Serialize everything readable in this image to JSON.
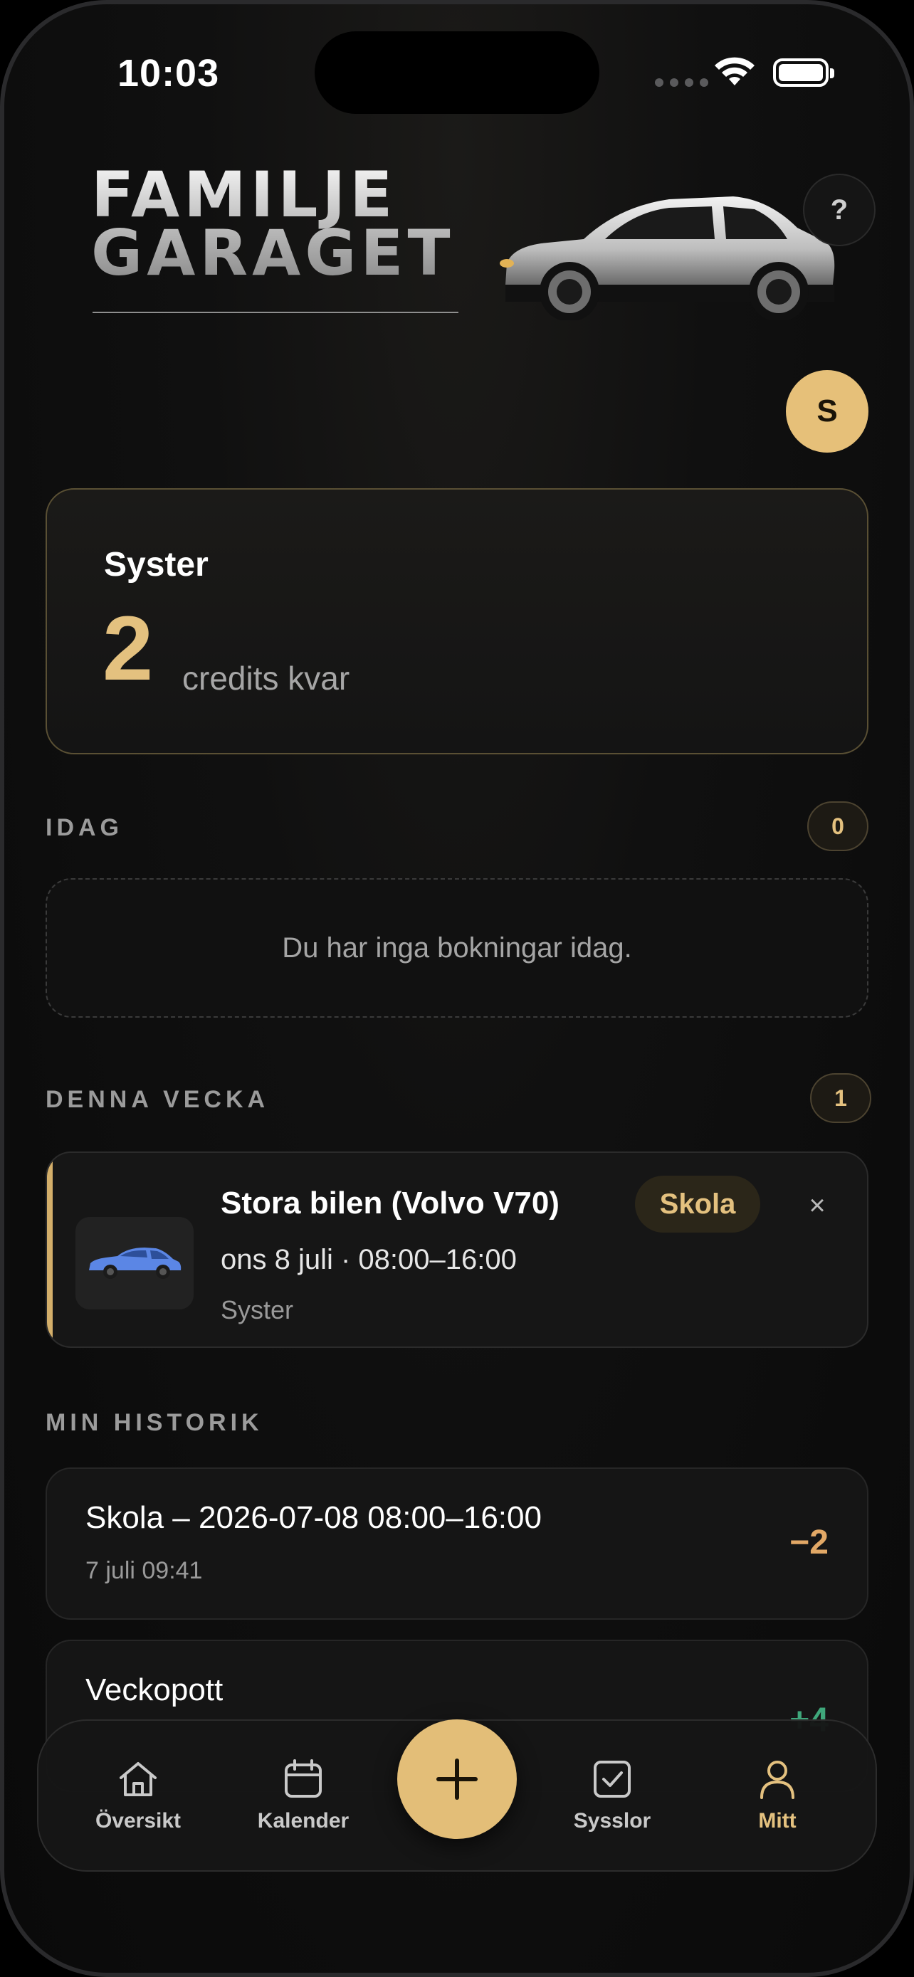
{
  "status_bar": {
    "time": "10:03"
  },
  "header": {
    "logo_line1": "FAMILJE",
    "logo_line2": "GARAGET",
    "help_label": "?",
    "avatar_initial": "S"
  },
  "credits": {
    "user_name": "Syster",
    "amount": "2",
    "label": "credits kvar"
  },
  "today": {
    "title": "IDAG",
    "count": "0",
    "empty_message": "Du har inga bokningar idag."
  },
  "this_week": {
    "title": "DENNA VECKA",
    "count": "1",
    "bookings": [
      {
        "car": "Stora bilen (Volvo V70)",
        "time": "ons 8 juli · 08:00–16:00",
        "user": "Syster",
        "tag": "Skola",
        "close": "×"
      }
    ]
  },
  "history": {
    "title": "MIN HISTORIK",
    "items": [
      {
        "title": "Skola – 2026-07-08 08:00–16:00",
        "date": "7 juli 09:41",
        "delta": "−2",
        "delta_color": "#e2a866"
      },
      {
        "title": "Veckopott",
        "date": "",
        "delta": "+4",
        "delta_color": "#3fa77b"
      }
    ]
  },
  "tabbar": {
    "tabs": [
      {
        "label": "Översikt",
        "icon": "home-icon"
      },
      {
        "label": "Kalender",
        "icon": "calendar-icon"
      },
      {
        "label": "Sysslor",
        "icon": "checkbox-icon"
      },
      {
        "label": "Mitt",
        "icon": "person-icon",
        "active": true
      }
    ],
    "fab_icon": "plus-icon"
  },
  "colors": {
    "accent": "#e4c17f",
    "background": "#0c0c0d",
    "card": "#161616",
    "car_blue": "#5b86e5"
  }
}
